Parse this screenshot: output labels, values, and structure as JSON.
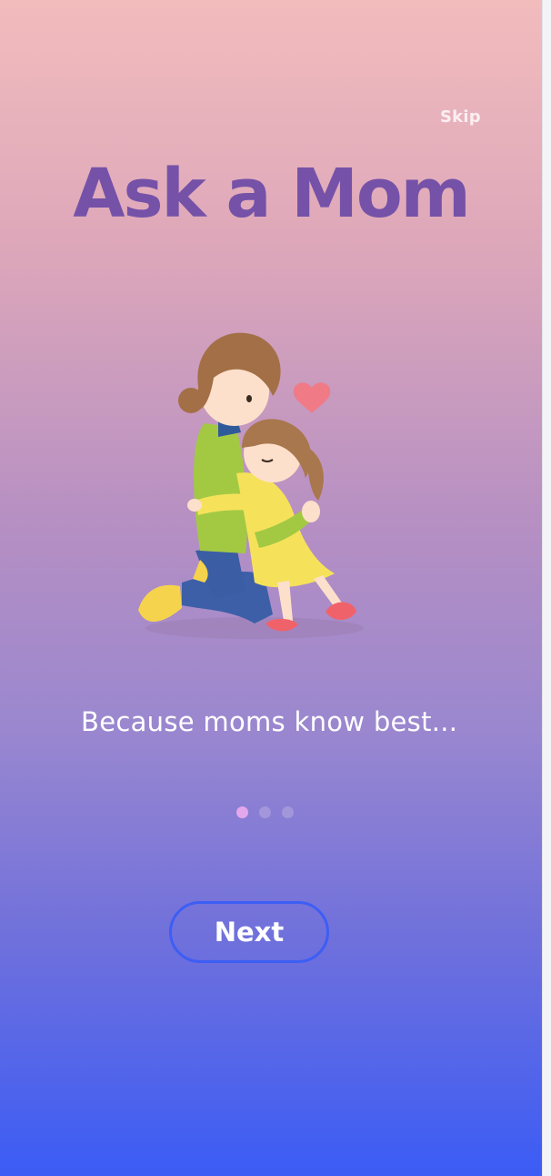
{
  "onboarding": {
    "skip_label": "Skip",
    "title": "Ask a Mom",
    "tagline": "Because moms know best...",
    "next_label": "Next",
    "pager": {
      "total": 3,
      "active_index": 0
    }
  },
  "illustration": {
    "icon": "mother-hugging-daughter-illustration"
  },
  "colors": {
    "title": "#7552a8",
    "button_border": "#3d5ef4",
    "dot_active": "#e3a8ec",
    "dot_inactive": "#a496db",
    "gradient_top": "#f2bcbd",
    "gradient_bottom": "#3b5cf5"
  }
}
